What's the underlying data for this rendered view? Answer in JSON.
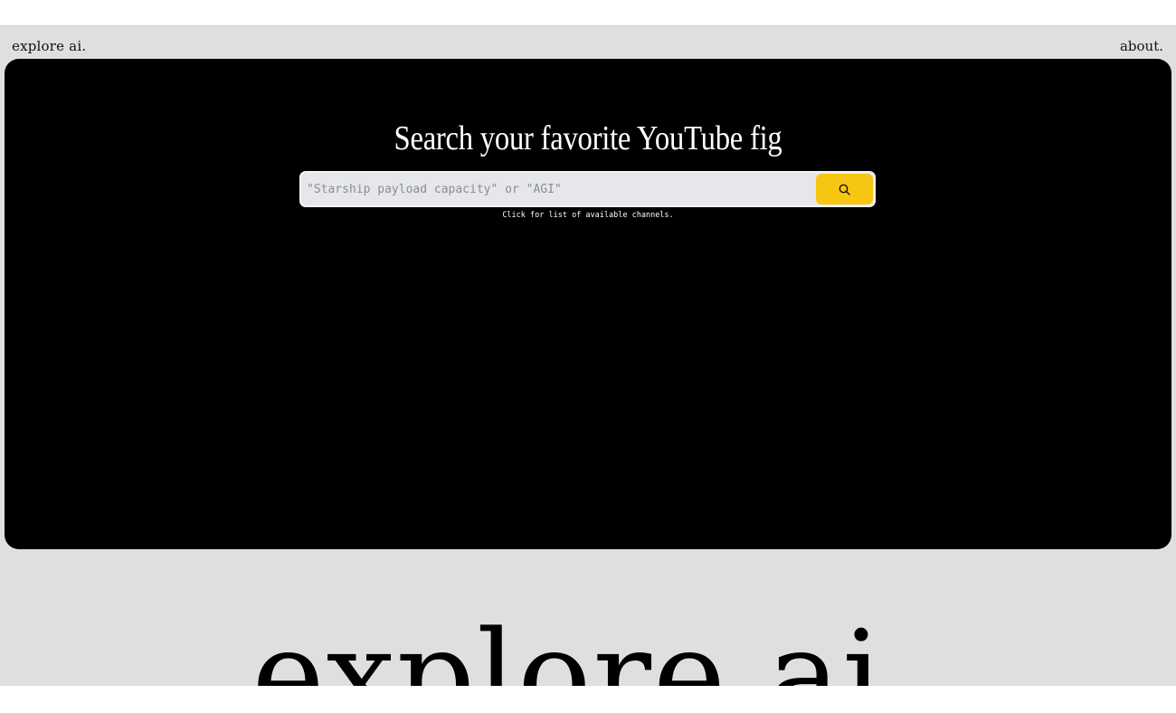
{
  "nav": {
    "brand": "explore ai.",
    "about_label": "about."
  },
  "hero": {
    "title": "Search your favorite YouTube fig"
  },
  "search": {
    "placeholder": "\"Starship payload capacity\" or \"AGI\"",
    "value": "",
    "button_icon": "search-icon"
  },
  "channels_hint": "Click for list of available channels.",
  "footer": {
    "wordmark": "explore ai."
  },
  "colors": {
    "page_bg": "#dfdfdf",
    "hero_bg": "#000000",
    "accent": "#f7c613",
    "input_bg": "#e6e7ea"
  }
}
